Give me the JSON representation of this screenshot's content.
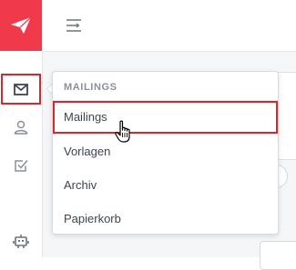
{
  "sidebar": {
    "items": [
      {
        "icon": "mail-icon",
        "active": true
      },
      {
        "icon": "user-icon",
        "active": false
      },
      {
        "icon": "checkbox-icon",
        "active": false
      },
      {
        "icon": "robot-icon",
        "active": false
      }
    ]
  },
  "colors": {
    "brand": "#f03a4b",
    "highlight": "#d9262f"
  },
  "dropdown": {
    "header": "MAILINGS",
    "items": [
      {
        "label": "Mailings",
        "selected": true
      },
      {
        "label": "Vorlagen",
        "selected": false
      },
      {
        "label": "Archiv",
        "selected": false
      },
      {
        "label": "Papierkorb",
        "selected": false
      }
    ]
  }
}
